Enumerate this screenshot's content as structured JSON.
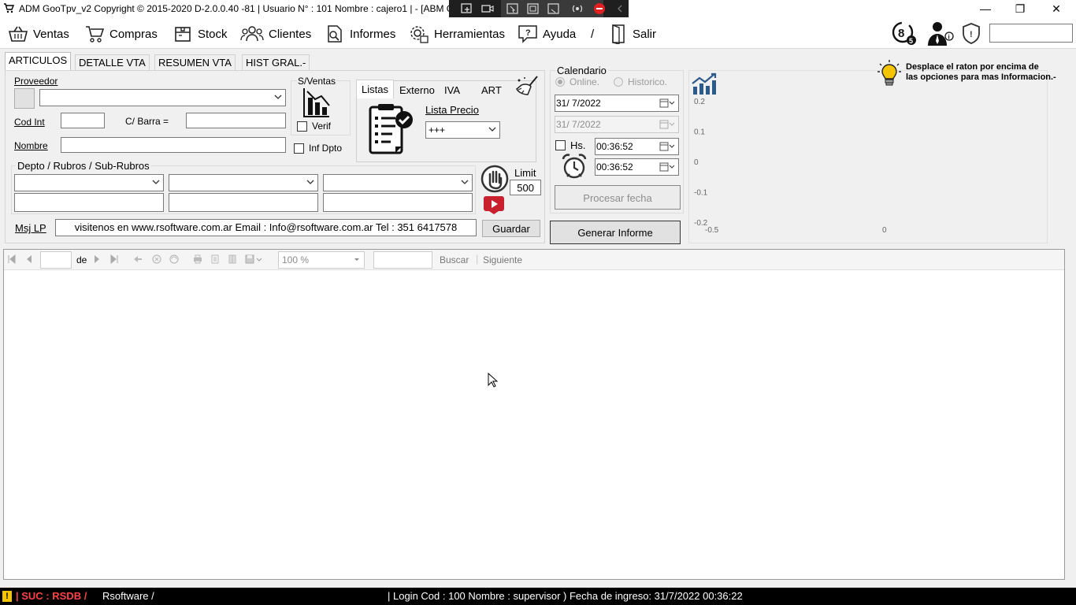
{
  "window": {
    "title": "ADM GooTpv_v2 Copyright ©  2015-2020 D-2.0.0.40 -81 | Usuario N° : 101 Nombre : cajero1 | - [ABM Ger",
    "buttons": {
      "minimize": "—",
      "restore": "❐",
      "close": "✕"
    }
  },
  "menu": {
    "ventas": "Ventas",
    "compras": "Compras",
    "stock": "Stock",
    "clientes": "Clientes",
    "informes": "Informes",
    "herramientas": "Herramientas",
    "ayuda": "Ayuda",
    "separator": "/",
    "salir": "Salir",
    "search_value": ""
  },
  "tabs": [
    "ARTICULOS",
    "DETALLE VTA",
    "RESUMEN VTA",
    "HIST GRAL.-"
  ],
  "articulos": {
    "proveedor_label": "Proveedor",
    "proveedor_value": "",
    "cod_int_label": "Cod Int",
    "cod_int_value": "",
    "cbarra_label": "C/ Barra =",
    "cbarra_value": "",
    "nombre_label": "Nombre",
    "nombre_value": "",
    "sventas_label": "S/Ventas",
    "verif_label": "Verif",
    "inf_dpto_label": "Inf Dpto",
    "depto_label": "Depto / Rubros / Sub-Rubros",
    "limit_label": "Limit",
    "limit_value": "500",
    "msj_lp_label": "Msj LP",
    "msj_lp_value": "visitenos en www.rsoftware.com.ar Email : Info@rsoftware.com.ar Tel : 351 6417578",
    "guardar_label": "Guardar"
  },
  "listas": {
    "tabs": [
      "Listas",
      "Externo",
      "IVA",
      "ART"
    ],
    "lista_precio_label": "Lista Precio",
    "lista_precio_value": "+++"
  },
  "calendario": {
    "title": "Calendario",
    "online_label": "Online.",
    "historico_label": "Historico.",
    "date1": "31/  7/2022",
    "date2": "31/  7/2022",
    "hs_label": "Hs.",
    "time1": "00:36:52",
    "time2": "00:36:52",
    "procesar_label": "Procesar fecha",
    "generar_label": "Generar Informe"
  },
  "hint": {
    "line1": "Desplace el raton por encima de",
    "line2": "las opciones para mas Informacion.-"
  },
  "chart_data": {
    "type": "line",
    "series": [],
    "yticks": [
      "0.2",
      "0.1",
      "0",
      "-0.1",
      "-0.2"
    ],
    "xticks": [
      "-0.5",
      "0"
    ],
    "xlim": [
      -0.5,
      0
    ],
    "ylim": [
      -0.2,
      0.2
    ]
  },
  "report_toolbar": {
    "page_value": "",
    "de_label": "de",
    "zoom_value": "100 %",
    "search_value": "",
    "buscar_label": "Buscar",
    "siguiente_label": "Siguiente"
  },
  "status": {
    "left": "| SUC : RSDB /",
    "company": "Rsoftware /",
    "login": "| Login Cod : 100 Nombre : supervisor ) Fecha de ingreso: 31/7/2022 00:36:22"
  },
  "colors": {
    "status_warn": "#ff4040",
    "accent_chart": "#2a5b8c",
    "hint_bulb": "#f5c400"
  }
}
